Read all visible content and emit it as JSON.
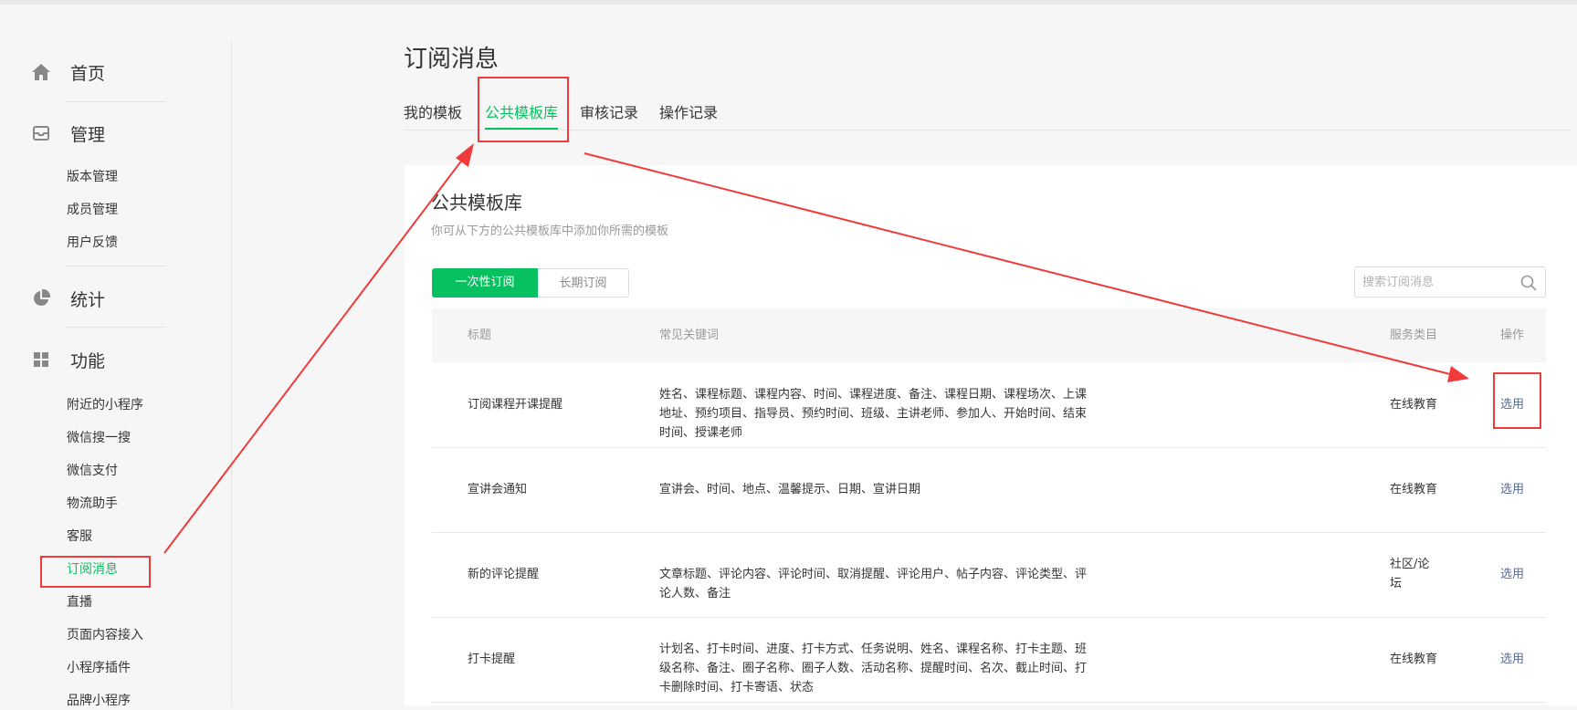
{
  "sidebar": {
    "sections": [
      {
        "label": "首页",
        "icon": "home-icon"
      },
      {
        "label": "管理",
        "icon": "inbox-icon"
      },
      {
        "label": "统计",
        "icon": "pie-chart-icon"
      },
      {
        "label": "功能",
        "icon": "grid-icon"
      }
    ],
    "manage_items": [
      "版本管理",
      "成员管理",
      "用户反馈"
    ],
    "feature_items": [
      "附近的小程序",
      "微信搜一搜",
      "微信支付",
      "物流助手",
      "客服",
      "订阅消息",
      "直播",
      "页面内容接入",
      "小程序插件",
      "品牌小程序"
    ],
    "active_item": "订阅消息"
  },
  "page": {
    "title": "订阅消息",
    "tabs": [
      "我的模板",
      "公共模板库",
      "审核记录",
      "操作记录"
    ],
    "active_tab": "公共模板库"
  },
  "card": {
    "title": "公共模板库",
    "subtitle": "你可从下方的公共模板库中添加你所需的模板",
    "segments": [
      "一次性订阅",
      "长期订阅"
    ],
    "active_segment": "一次性订阅",
    "search_placeholder": "搜索订阅消息"
  },
  "table": {
    "headers": {
      "title": "标题",
      "keywords": "常见关键词",
      "category": "服务类目",
      "action": "操作"
    },
    "rows": [
      {
        "title": "订阅课程开课提醒",
        "keywords": "姓名、课程标题、课程内容、时间、课程进度、备注、课程日期、课程场次、上课地址、预约项目、指导员、预约时间、班级、主讲老师、参加人、开始时间、结束时间、授课老师",
        "category": "在线教育",
        "action": "选用"
      },
      {
        "title": "宣讲会通知",
        "keywords": "宣讲会、时间、地点、温馨提示、日期、宣讲日期",
        "category": "在线教育",
        "action": "选用"
      },
      {
        "title": "新的评论提醒",
        "keywords": "文章标题、评论内容、评论时间、取消提醒、评论用户、帖子内容、评论类型、评论人数、备注",
        "category": "社区/论坛",
        "action": "选用"
      },
      {
        "title": "打卡提醒",
        "keywords": "计划名、打卡时间、进度、打卡方式、任务说明、姓名、课程名称、打卡主题、班级名称、备注、圈子名称、圈子人数、活动名称、提醒时间、名次、截止时间、打卡删除时间、打卡寄语、状态",
        "category": "在线教育",
        "action": "选用"
      }
    ]
  },
  "colors": {
    "accent": "#07c160",
    "link": "#576b95",
    "annotation": "#f03b3b",
    "background": "#f6f6f6"
  }
}
